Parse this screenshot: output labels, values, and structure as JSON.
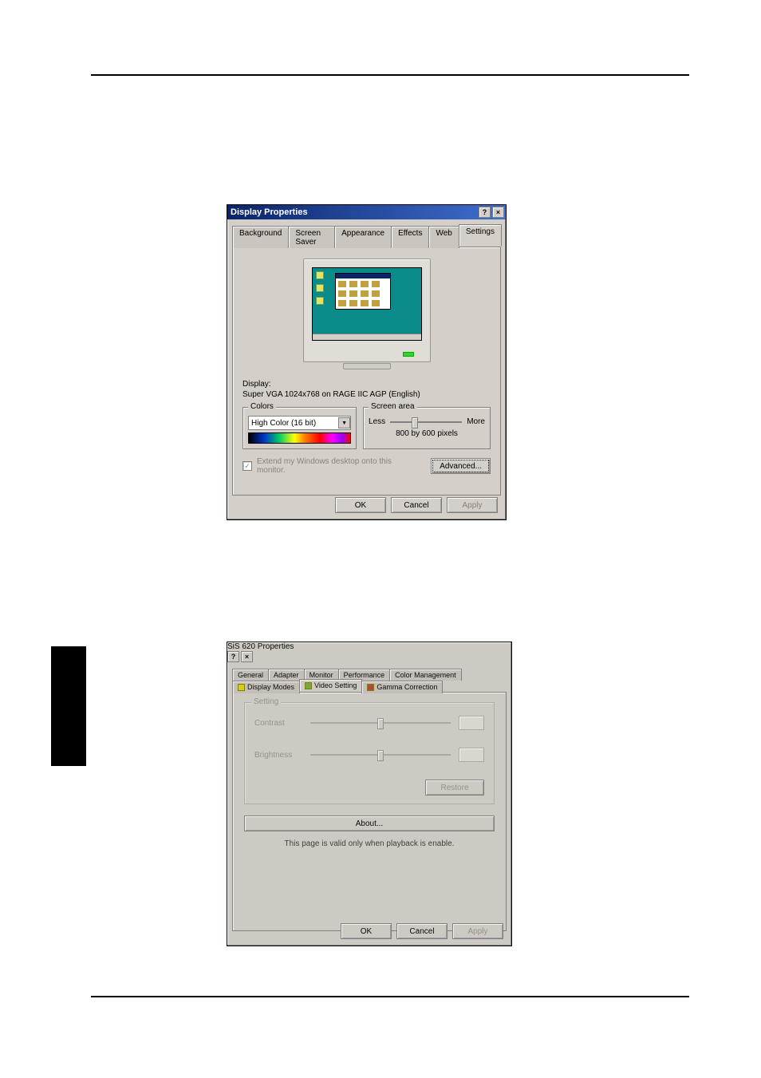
{
  "dialog1": {
    "title": "Display Properties",
    "titlebar_buttons": {
      "help": "?",
      "close": "×"
    },
    "tabs": [
      "Background",
      "Screen Saver",
      "Appearance",
      "Effects",
      "Web",
      "Settings"
    ],
    "active_tab": "Settings",
    "display_label": "Display:",
    "display_text": "Super VGA 1024x768 on RAGE IIC AGP (English)",
    "colors_group": "Colors",
    "colors_value": "High Color (16 bit)",
    "screen_area_group": "Screen area",
    "screen_area_less": "Less",
    "screen_area_more": "More",
    "screen_area_value": "800 by 600 pixels",
    "extend_checkbox": "Extend my Windows desktop onto this monitor.",
    "extend_checked": false,
    "advanced_button": "Advanced...",
    "ok_button": "OK",
    "cancel_button": "Cancel",
    "apply_button": "Apply"
  },
  "dialog2": {
    "title": "SiS 620 Properties",
    "titlebar_buttons": {
      "help": "?",
      "close": "×"
    },
    "tabs_row1": [
      "General",
      "Adapter",
      "Monitor",
      "Performance",
      "Color Management"
    ],
    "tabs_row2": [
      {
        "icon": "y",
        "label": "Display Modes"
      },
      {
        "icon": "g",
        "label": "Video Setting"
      },
      {
        "icon": "r",
        "label": "Gamma Correction"
      }
    ],
    "active_tab": "Video Setting",
    "setting_group": "Setting",
    "contrast_label": "Contrast",
    "contrast_value": "",
    "brightness_label": "Brightness",
    "brightness_value": "",
    "restore_button": "Restore",
    "about_button": "About...",
    "note": "This page is valid only when playback is enable.",
    "ok_button": "OK",
    "cancel_button": "Cancel",
    "apply_button": "Apply"
  }
}
